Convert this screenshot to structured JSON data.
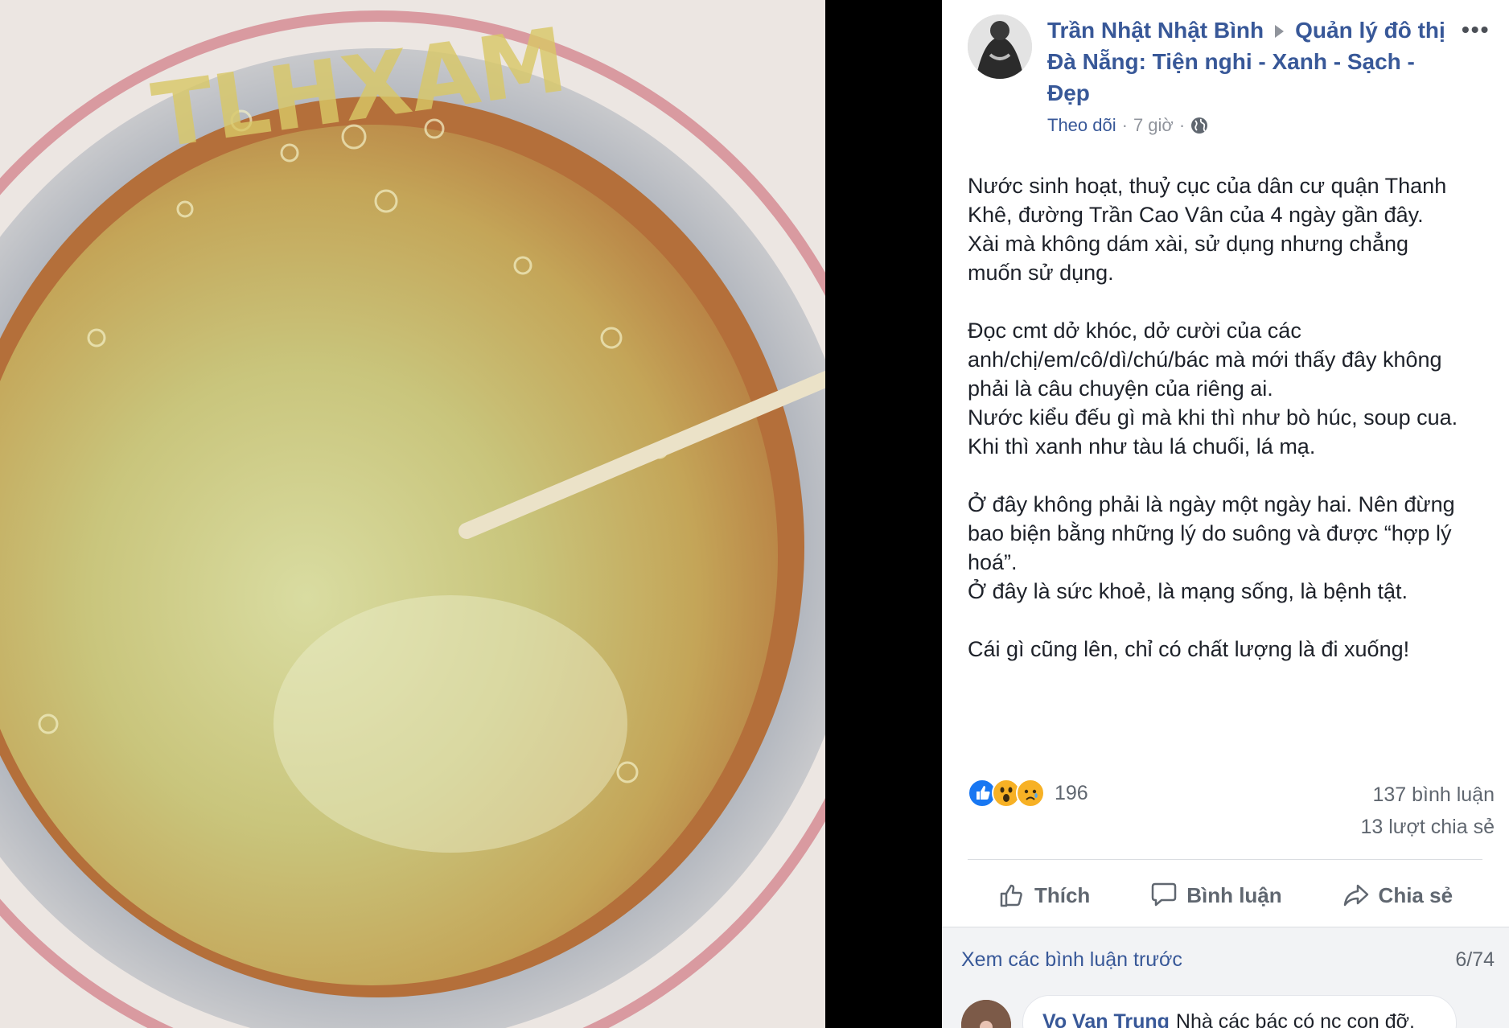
{
  "post": {
    "author": "Trần Nhật Nhật Bình",
    "group_line1": "Quản lý đô thị",
    "group_line2": "Đà Nẵng: Tiện nghi - Xanh - Sạch -",
    "group_line3": "Đẹp",
    "more_label": "•••",
    "follow_label": "Theo dõi",
    "meta_sep1": "·",
    "time": "7 giờ",
    "meta_sep2": "·",
    "privacy_icon": "globe-icon",
    "paragraphs": [
      [
        "Nước sinh hoạt, thuỷ cục của dân cư quận Thanh",
        "Khê, đường Trần Cao Vân của 4 ngày gần đây.",
        "Xài mà không dám xài, sử dụng nhưng chẳng",
        "muốn sử dụng."
      ],
      [
        "Đọc cmt dở khóc, dở cười của các",
        "anh/chị/em/cô/dì/chú/bác mà mới thấy đây không",
        "phải là câu chuyện của riêng ai.",
        "Nước kiểu đếu gì mà khi thì như bò húc, soup cua.",
        "Khi thì xanh như tàu lá chuối, lá mạ."
      ],
      [
        "Ở đây không phải là ngày một ngày hai. Nên đừng",
        "bao biện bằng những lý do suông và được “hợp lý",
        "hoá”.",
        "Ở đây là sức khoẻ, là mạng sống, là bệnh tật."
      ],
      [
        "Cái gì cũng lên, chỉ có chất lượng là đi xuống!"
      ]
    ]
  },
  "photo": {
    "watermark_text": "TLHXAM"
  },
  "reactions": {
    "icons": [
      "like-reaction-icon",
      "wow-reaction-icon",
      "sad-reaction-icon"
    ],
    "count": "196",
    "comments_count": "137 bình luận",
    "shares_count": "13 lượt chia sẻ"
  },
  "actions": {
    "like": "Thích",
    "comment": "Bình luận",
    "share": "Chia sẻ"
  },
  "comments": {
    "view_previous": "Xem các bình luận trước",
    "page_count": "6/74",
    "items": [
      {
        "name": "Vo Van Trung",
        "text": "Nhà các bác có nc con đỡ."
      }
    ]
  },
  "colors": {
    "link": "#385898",
    "text": "#1d2129",
    "muted": "#606770",
    "like": "#1877f2",
    "wow": "#f7b125"
  }
}
